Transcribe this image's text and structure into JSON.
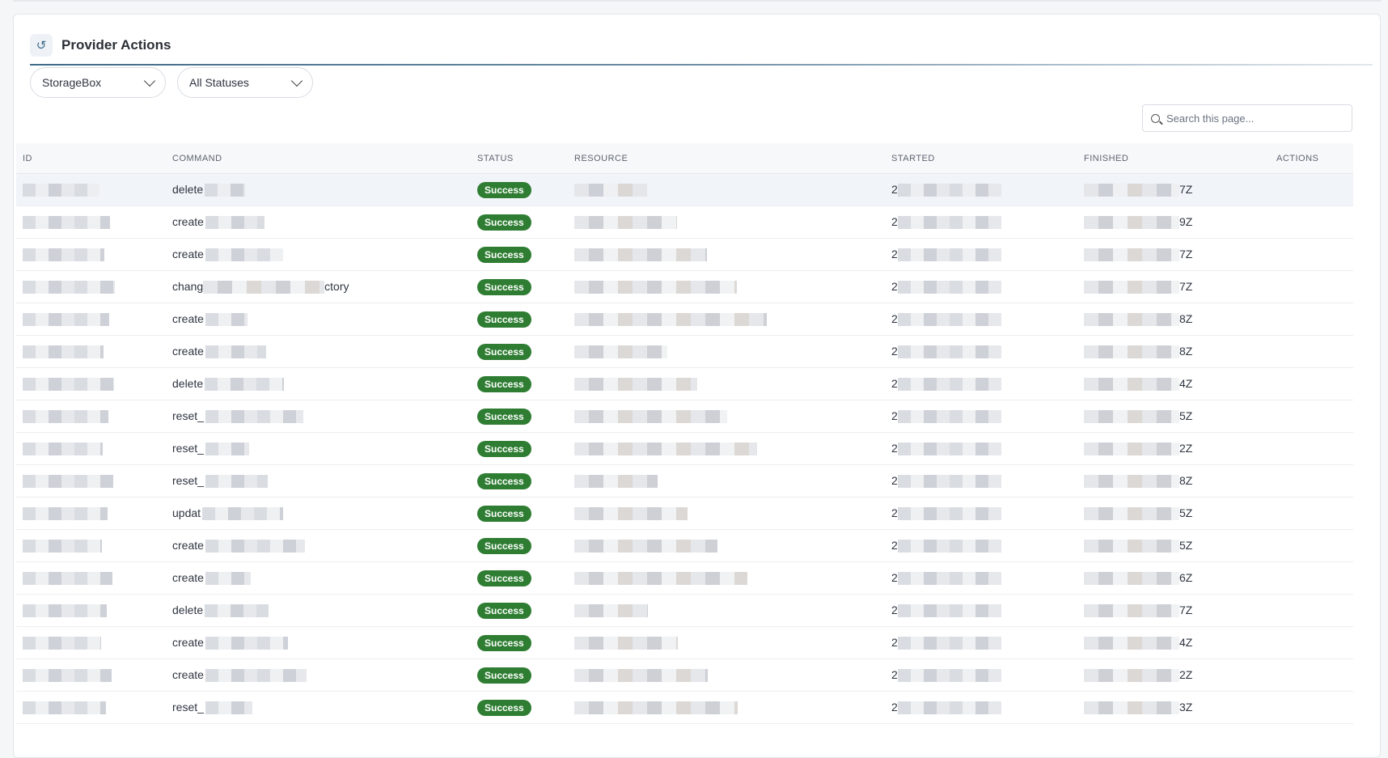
{
  "panel": {
    "title": "Provider Actions",
    "icon": "history-icon"
  },
  "filters": {
    "provider": "StorageBox",
    "status": "All Statuses"
  },
  "search": {
    "placeholder": "Search this page..."
  },
  "table": {
    "columns": [
      "ID",
      "COMMAND",
      "STATUS",
      "RESOURCE",
      "STARTED",
      "FINISHED",
      "ACTIONS"
    ],
    "rows": [
      {
        "command": "delete",
        "status": "Success",
        "started": "2",
        "finished": "7Z"
      },
      {
        "command": "create",
        "status": "Success",
        "started": "2",
        "finished": "9Z"
      },
      {
        "command": "create",
        "status": "Success",
        "started": "2",
        "finished": "7Z"
      },
      {
        "command": "chang",
        "command_tail": "ctory",
        "status": "Success",
        "started": "2",
        "finished": "7Z"
      },
      {
        "command": "create",
        "status": "Success",
        "started": "2",
        "finished": "8Z"
      },
      {
        "command": "create",
        "status": "Success",
        "started": "2",
        "finished": "8Z"
      },
      {
        "command": "delete",
        "status": "Success",
        "started": "2",
        "finished": "4Z"
      },
      {
        "command": "reset_",
        "status": "Success",
        "started": "2",
        "finished": "5Z"
      },
      {
        "command": "reset_",
        "status": "Success",
        "started": "2",
        "finished": "2Z"
      },
      {
        "command": "reset_",
        "status": "Success",
        "started": "2",
        "finished": "8Z"
      },
      {
        "command": "updat",
        "status": "Success",
        "started": "2",
        "finished": "5Z"
      },
      {
        "command": "create",
        "status": "Success",
        "started": "2",
        "finished": "5Z"
      },
      {
        "command": "create",
        "status": "Success",
        "started": "2",
        "finished": "6Z"
      },
      {
        "command": "delete",
        "status": "Success",
        "started": "2",
        "finished": "7Z"
      },
      {
        "command": "create",
        "status": "Success",
        "started": "2",
        "finished": "4Z"
      },
      {
        "command": "create",
        "status": "Success",
        "started": "2",
        "finished": "2Z"
      },
      {
        "command": "reset_",
        "status": "Success",
        "started": "2",
        "finished": "3Z"
      }
    ]
  },
  "colors": {
    "success": "#2e7d32",
    "accent": "#3f6b8a"
  }
}
